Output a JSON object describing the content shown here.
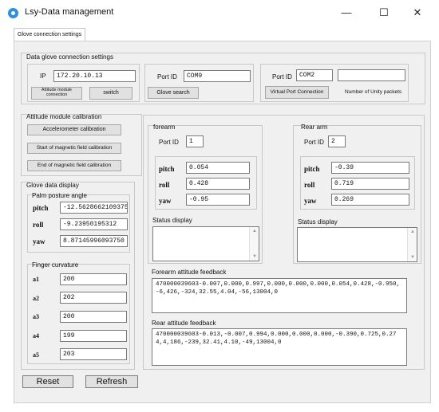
{
  "window": {
    "title": "Lsy-Data management",
    "controls": {
      "minimize": "—",
      "maximize": "☐",
      "close": "✕"
    }
  },
  "tabs": [
    {
      "label": "Glove connection settings"
    }
  ],
  "connection": {
    "group_title": "Data glove connection settings",
    "ip_label": "IP",
    "ip_value": "172.20.10.13",
    "attitude_button": "Attitude module connection",
    "switch_button": "switch",
    "port_label": "Port ID",
    "port_value": "COM9",
    "glove_search_button": "Glove search",
    "port2_label": "Port ID",
    "port2_value": "COM2",
    "unity_packets_value": "",
    "virtual_port_button": "Virtual Port Connection",
    "unity_packets_label": "Number of Unity packets"
  },
  "calibration": {
    "group_title": "Attitude module calibration",
    "accelerometer_button": "Accelerometer calibration",
    "start_magnetic_button": "Start of magnetic field calibration",
    "end_magnetic_button": "End of magnetic field calibration"
  },
  "glove_display": {
    "group_title": "Glove data display",
    "palm_title": "Palm posture angle",
    "palm": [
      {
        "label": "pitch",
        "value": "-12.5628662109375"
      },
      {
        "label": "roll",
        "value": "-9.23950195312"
      },
      {
        "label": "yaw",
        "value": "8.87145996093750"
      }
    ],
    "finger_title": "Finger curvature",
    "fingers": [
      {
        "label": "a1",
        "value": "200"
      },
      {
        "label": "a2",
        "value": "202"
      },
      {
        "label": "a3",
        "value": "200"
      },
      {
        "label": "a4",
        "value": "199"
      },
      {
        "label": "a5",
        "value": "203"
      }
    ]
  },
  "forearm": {
    "title": "forearm",
    "port_label": "Port ID",
    "port_value": "1",
    "angles": [
      {
        "label": "pitch",
        "value": "0.054"
      },
      {
        "label": "roll",
        "value": "0.428"
      },
      {
        "label": "yaw",
        "value": "-0.95"
      }
    ],
    "status_label": "Status display"
  },
  "rear_arm": {
    "title": "Rear arm",
    "port_label": "Port ID",
    "port_value": "2",
    "angles": [
      {
        "label": "pitch",
        "value": "-0.39"
      },
      {
        "label": "roll",
        "value": "0.719"
      },
      {
        "label": "yaw",
        "value": "0.269"
      }
    ],
    "status_label": "Status display"
  },
  "feedback": {
    "forearm_label": "Forearm attitude feedback",
    "forearm_text": "470000039603-0.007,0.000,0.997,0.000,0.000,0.000,0.054,0.428,-0.950,-6,426,-324,32.55,4.04,-56,13004,0",
    "rear_label": "Rear attitude feedback",
    "rear_text": "470000039603-0.013,-0.007,0.994,0.000,0.000,0.000,-0.390,0.725,0.274,4,186,-239,32.41,4.10,-49,13004,0"
  },
  "bottom": {
    "reset_button": "Reset",
    "refresh_button": "Refresh"
  },
  "colors": {
    "window_bg": "#ffffff",
    "panel_bg": "#f0f0f0",
    "button_bg": "#e1e1e1",
    "icon_blue": "#2f8fd8"
  }
}
